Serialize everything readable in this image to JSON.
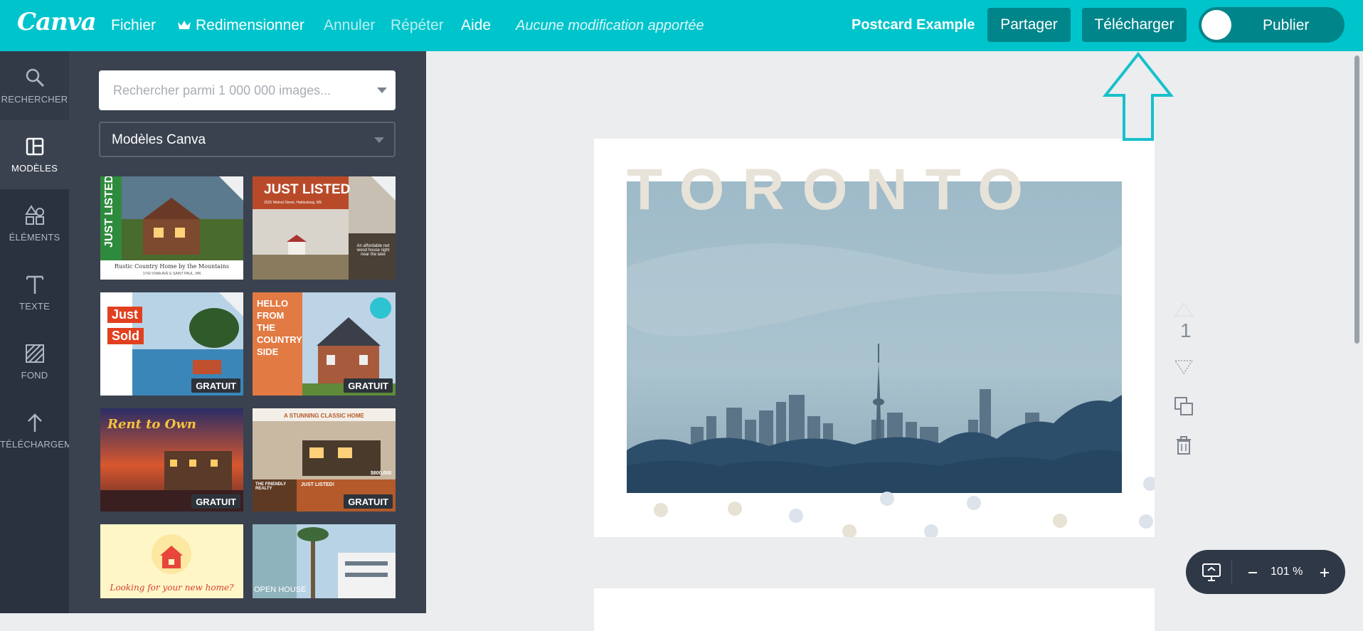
{
  "app": {
    "logo": "Canva"
  },
  "topbar": {
    "menu": {
      "file": "Fichier",
      "resize": "Redimensionner",
      "undo": "Annuler",
      "redo": "Répéter",
      "help": "Aide"
    },
    "status": "Aucune modification apportée",
    "doc_title": "Postcard Example",
    "share_label": "Partager",
    "download_label": "Télécharger",
    "publish_label": "Publier",
    "accent_color": "#00c4cc",
    "button_color": "#00858a"
  },
  "rail": {
    "items": [
      {
        "label": "RECHERCHER",
        "icon": "search-icon"
      },
      {
        "label": "MODÈLES",
        "icon": "layout-icon",
        "active": true
      },
      {
        "label": "ÉLÉMENTS",
        "icon": "shapes-icon"
      },
      {
        "label": "TEXTE",
        "icon": "text-icon"
      },
      {
        "label": "FOND",
        "icon": "background-icon"
      },
      {
        "label": "TÉLÉCHARGEMENTS",
        "icon": "upload-icon"
      }
    ]
  },
  "panel": {
    "search_placeholder": "Rechercher parmi 1 000 000 images...",
    "filter_value": "Modèles Canva",
    "templates": [
      {
        "title_text": "JUST LISTED!",
        "caption": "Rustic Country Home by the Mountains",
        "subcaption": "1742 IOWA AVE E SAINT PAUL, MN",
        "badge": ""
      },
      {
        "title_text": "JUST LISTED",
        "caption": "1525 Walnut Street, Hattiesburg, MS",
        "subcaption": "An affordable red wood house right near the lake",
        "badge": ""
      },
      {
        "title_text": "Just",
        "title_text2": "Sold",
        "badge": "GRATUIT"
      },
      {
        "title_text": "HELLO FROM THE COUNTRY SIDE",
        "badge": "GRATUIT"
      },
      {
        "title_text": "Rent to Own",
        "badge": "GRATUIT"
      },
      {
        "title_text": "A STUNNING CLASSIC HOME",
        "price": "$800,000",
        "caption": "THE FRIENDLY REALTY",
        "subcaption": "JUST LISTED!",
        "badge": "GRATUIT"
      },
      {
        "title_text": "Looking for your new home?",
        "badge": ""
      },
      {
        "title_text": "OPEN HOUSE",
        "badge": ""
      }
    ]
  },
  "canvas": {
    "headline": "TORONTO",
    "page_number": "1",
    "zoom": "101 %"
  }
}
